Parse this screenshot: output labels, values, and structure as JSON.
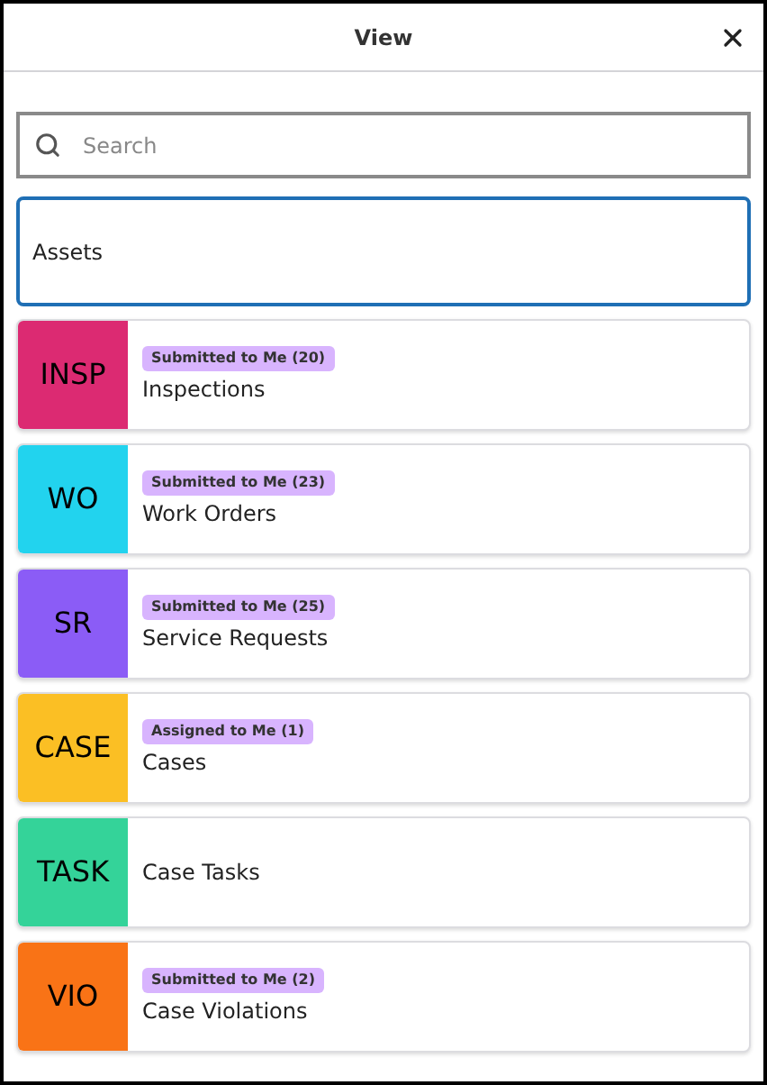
{
  "header": {
    "title": "View"
  },
  "search": {
    "placeholder": "Search"
  },
  "items": [
    {
      "label": "Assets",
      "selected": true
    },
    {
      "code": "INSP",
      "color": "#dc2a72",
      "badge": "Submitted to Me (20)",
      "label": "Inspections",
      "selected": false
    },
    {
      "code": "WO",
      "color": "#22d3ee",
      "badge": "Submitted to Me (23)",
      "label": "Work Orders",
      "selected": false
    },
    {
      "code": "SR",
      "color": "#8b5cf6",
      "badge": "Submitted to Me (25)",
      "label": "Service Requests",
      "selected": false
    },
    {
      "code": "CASE",
      "color": "#fbbf24",
      "badge": "Assigned to Me (1)",
      "label": "Cases",
      "selected": false
    },
    {
      "code": "TASK",
      "color": "#34d399",
      "label": "Case Tasks",
      "selected": false
    },
    {
      "code": "VIO",
      "color": "#f97316",
      "badge": "Submitted to Me (2)",
      "label": "Case Violations",
      "selected": false
    }
  ]
}
